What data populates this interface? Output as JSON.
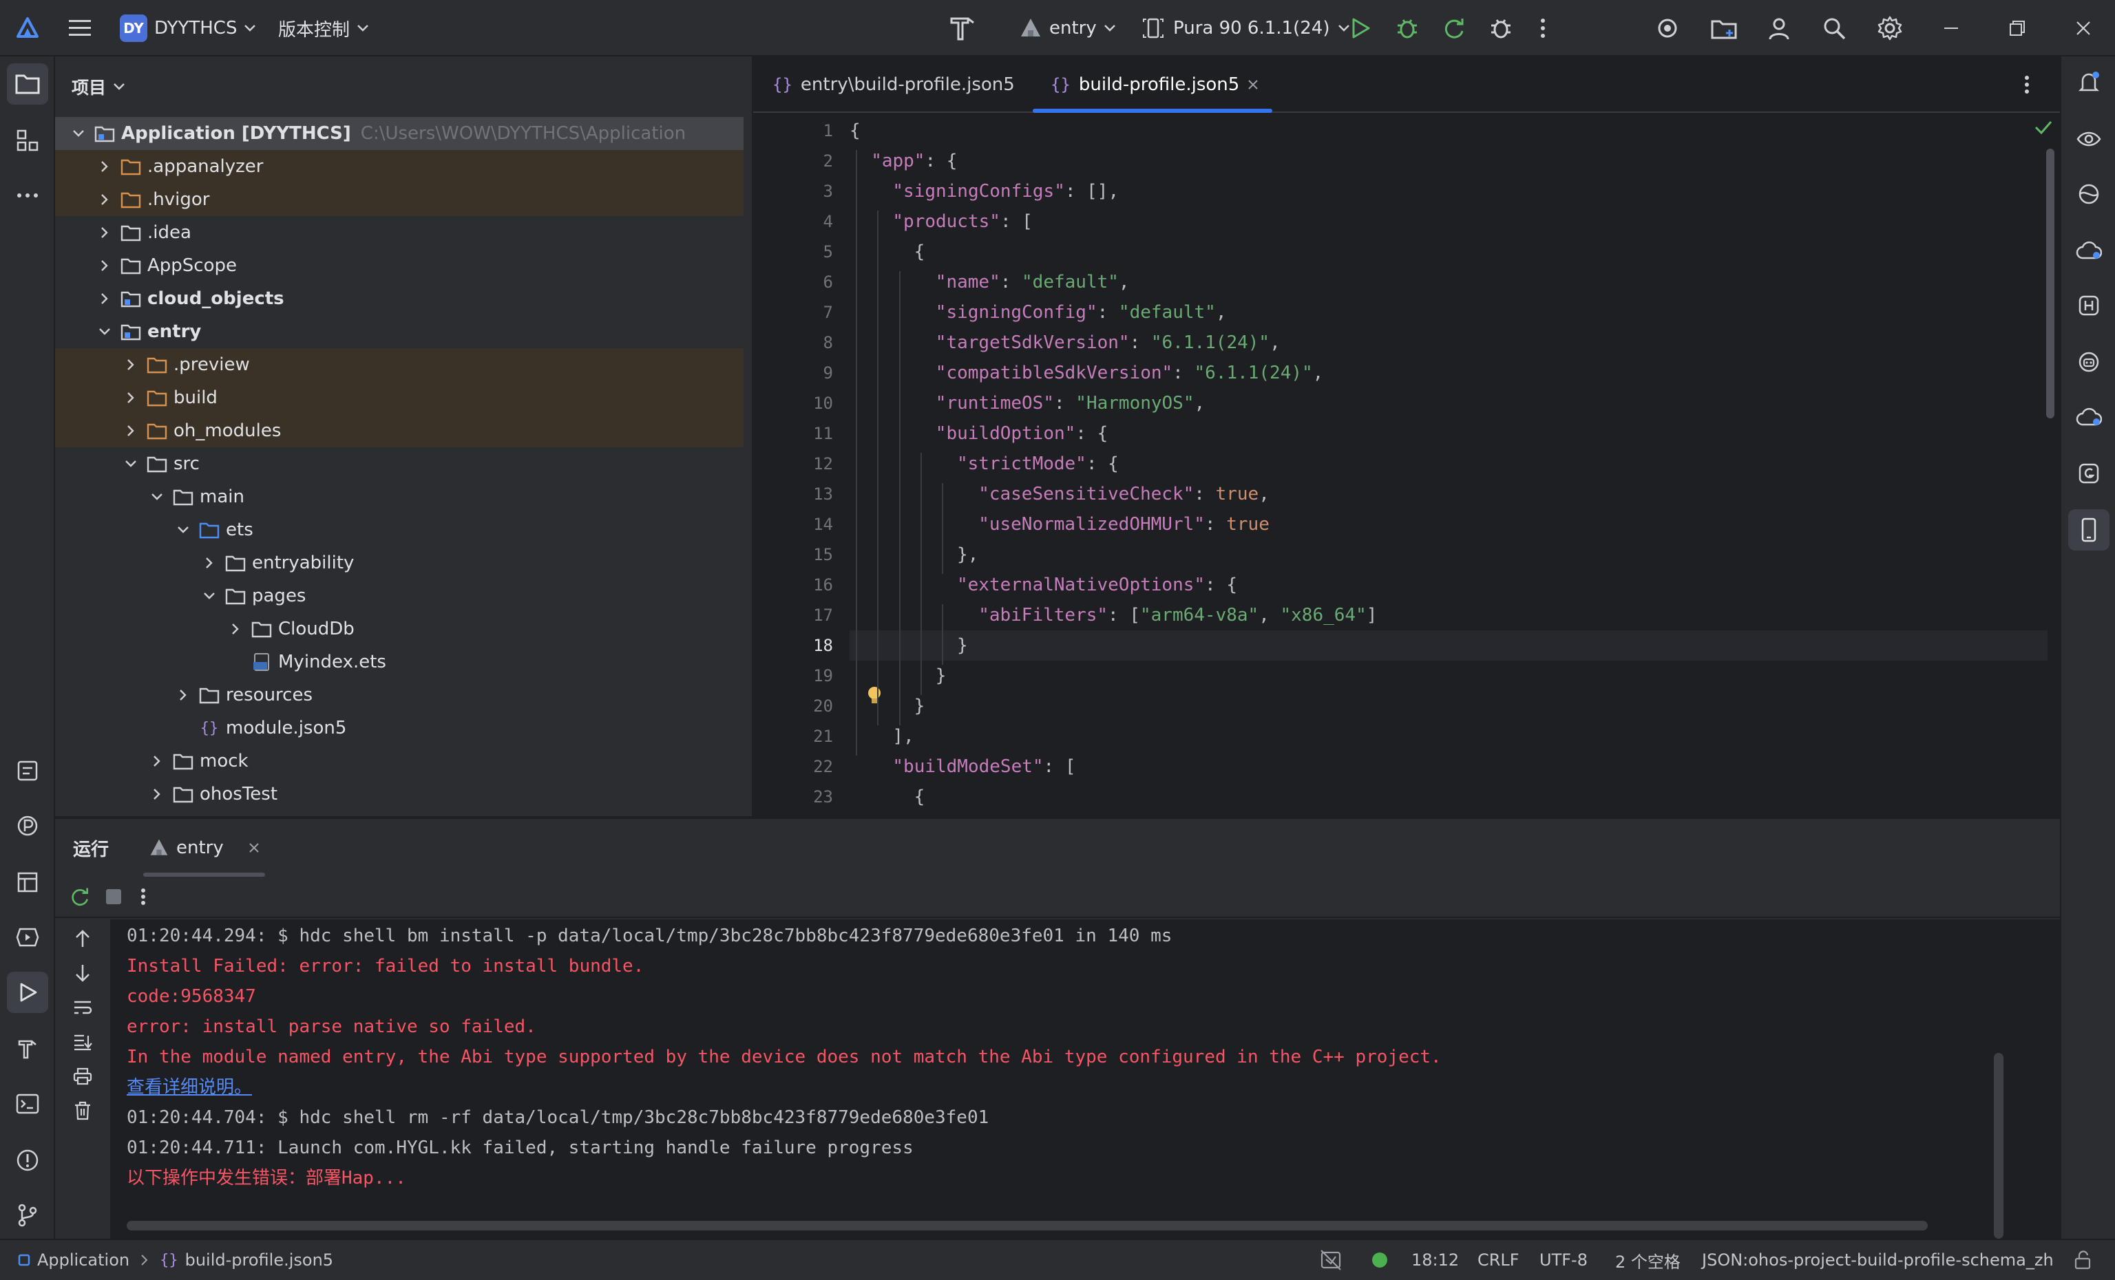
{
  "titlebar": {
    "project_badge": "DY",
    "project_name": "DYYTHCS",
    "vcs_label": "版本控制",
    "run_config": "entry",
    "device": "Pura 90 6.1.1(24)"
  },
  "project_panel": {
    "title": "项目",
    "tree": [
      {
        "name": "Application [DYYTHCS]",
        "path": "C:\\Users\\WOW\\DYYTHCS\\Application",
        "depth": 0,
        "expanded": true,
        "kind": "module",
        "highlight": "selected"
      },
      {
        "name": ".appanalyzer",
        "depth": 1,
        "expanded": false,
        "kind": "folder-orange",
        "highlight": "excluded"
      },
      {
        "name": ".hvigor",
        "depth": 1,
        "expanded": false,
        "kind": "folder-orange",
        "highlight": "excluded"
      },
      {
        "name": ".idea",
        "depth": 1,
        "expanded": false,
        "kind": "folder"
      },
      {
        "name": "AppScope",
        "depth": 1,
        "expanded": false,
        "kind": "folder"
      },
      {
        "name": "cloud_objects",
        "depth": 1,
        "expanded": false,
        "kind": "module",
        "bold": true
      },
      {
        "name": "entry",
        "depth": 1,
        "expanded": true,
        "kind": "module",
        "bold": true
      },
      {
        "name": ".preview",
        "depth": 2,
        "expanded": false,
        "kind": "folder-orange",
        "highlight": "excluded"
      },
      {
        "name": "build",
        "depth": 2,
        "expanded": false,
        "kind": "folder-orange",
        "highlight": "excluded"
      },
      {
        "name": "oh_modules",
        "depth": 2,
        "expanded": false,
        "kind": "folder-orange",
        "highlight": "excluded"
      },
      {
        "name": "src",
        "depth": 2,
        "expanded": true,
        "kind": "folder"
      },
      {
        "name": "main",
        "depth": 3,
        "expanded": true,
        "kind": "folder"
      },
      {
        "name": "ets",
        "depth": 4,
        "expanded": true,
        "kind": "folder-blue"
      },
      {
        "name": "entryability",
        "depth": 5,
        "expanded": false,
        "kind": "folder"
      },
      {
        "name": "pages",
        "depth": 5,
        "expanded": true,
        "kind": "folder"
      },
      {
        "name": "CloudDb",
        "depth": 6,
        "expanded": false,
        "kind": "folder"
      },
      {
        "name": "Myindex.ets",
        "depth": 6,
        "leaf": true,
        "kind": "ets-file"
      },
      {
        "name": "resources",
        "depth": 4,
        "expanded": false,
        "kind": "folder"
      },
      {
        "name": "module.json5",
        "depth": 4,
        "leaf": true,
        "kind": "json-file"
      },
      {
        "name": "mock",
        "depth": 3,
        "expanded": false,
        "kind": "folder"
      },
      {
        "name": "ohosTest",
        "depth": 3,
        "expanded": false,
        "kind": "folder"
      }
    ]
  },
  "editor": {
    "tabs": [
      {
        "label": "entry\\build-profile.json5",
        "active": false
      },
      {
        "label": "build-profile.json5",
        "active": true
      }
    ],
    "current_line": 18,
    "lines": [
      {
        "n": "1",
        "indent": 0,
        "tokens": [
          [
            "p",
            "{"
          ]
        ]
      },
      {
        "n": "2",
        "indent": 1,
        "tokens": [
          [
            "k",
            "\"app\""
          ],
          [
            "p",
            ": {"
          ]
        ]
      },
      {
        "n": "3",
        "indent": 2,
        "tokens": [
          [
            "k",
            "\"signingConfigs\""
          ],
          [
            "p",
            ": [],"
          ]
        ]
      },
      {
        "n": "4",
        "indent": 2,
        "tokens": [
          [
            "k",
            "\"products\""
          ],
          [
            "p",
            ": ["
          ]
        ]
      },
      {
        "n": "5",
        "indent": 3,
        "tokens": [
          [
            "p",
            "{"
          ]
        ]
      },
      {
        "n": "6",
        "indent": 4,
        "tokens": [
          [
            "k",
            "\"name\""
          ],
          [
            "p",
            ": "
          ],
          [
            "s",
            "\"default\""
          ],
          [
            "p",
            ","
          ]
        ]
      },
      {
        "n": "7",
        "indent": 4,
        "tokens": [
          [
            "k",
            "\"signingConfig\""
          ],
          [
            "p",
            ": "
          ],
          [
            "s",
            "\"default\""
          ],
          [
            "p",
            ","
          ]
        ]
      },
      {
        "n": "8",
        "indent": 4,
        "tokens": [
          [
            "k",
            "\"targetSdkVersion\""
          ],
          [
            "p",
            ": "
          ],
          [
            "s",
            "\"6.1.1(24)\""
          ],
          [
            "p",
            ","
          ]
        ]
      },
      {
        "n": "9",
        "indent": 4,
        "tokens": [
          [
            "k",
            "\"compatibleSdkVersion\""
          ],
          [
            "p",
            ": "
          ],
          [
            "s",
            "\"6.1.1(24)\""
          ],
          [
            "p",
            ","
          ]
        ]
      },
      {
        "n": "10",
        "indent": 4,
        "tokens": [
          [
            "k",
            "\"runtimeOS\""
          ],
          [
            "p",
            ": "
          ],
          [
            "s",
            "\"HarmonyOS\""
          ],
          [
            "p",
            ","
          ]
        ]
      },
      {
        "n": "11",
        "indent": 4,
        "tokens": [
          [
            "k",
            "\"buildOption\""
          ],
          [
            "p",
            ": {"
          ]
        ]
      },
      {
        "n": "12",
        "indent": 5,
        "tokens": [
          [
            "k",
            "\"strictMode\""
          ],
          [
            "p",
            ": {"
          ]
        ]
      },
      {
        "n": "13",
        "indent": 6,
        "tokens": [
          [
            "k",
            "\"caseSensitiveCheck\""
          ],
          [
            "p",
            ": "
          ],
          [
            "b",
            "true"
          ],
          [
            "p",
            ","
          ]
        ]
      },
      {
        "n": "14",
        "indent": 6,
        "tokens": [
          [
            "k",
            "\"useNormalizedOHMUrl\""
          ],
          [
            "p",
            ": "
          ],
          [
            "b",
            "true"
          ]
        ]
      },
      {
        "n": "15",
        "indent": 5,
        "tokens": [
          [
            "p",
            "},"
          ]
        ]
      },
      {
        "n": "16",
        "indent": 5,
        "tokens": [
          [
            "k",
            "\"externalNativeOptions\""
          ],
          [
            "p",
            ": {"
          ]
        ]
      },
      {
        "n": "17",
        "indent": 6,
        "tokens": [
          [
            "k",
            "\"abiFilters\""
          ],
          [
            "p",
            ": ["
          ],
          [
            "s",
            "\"arm64-v8a\""
          ],
          [
            "p",
            ", "
          ],
          [
            "s",
            "\"x86_64\""
          ],
          [
            "p",
            "]"
          ]
        ]
      },
      {
        "n": "18",
        "indent": 5,
        "tokens": [
          [
            "p",
            "}"
          ]
        ]
      },
      {
        "n": "19",
        "indent": 4,
        "tokens": [
          [
            "p",
            "}"
          ]
        ]
      },
      {
        "n": "20",
        "indent": 3,
        "tokens": [
          [
            "p",
            "}"
          ]
        ]
      },
      {
        "n": "21",
        "indent": 2,
        "tokens": [
          [
            "p",
            "],"
          ]
        ]
      },
      {
        "n": "22",
        "indent": 2,
        "tokens": [
          [
            "k",
            "\"buildModeSet\""
          ],
          [
            "p",
            ": ["
          ]
        ]
      },
      {
        "n": "23",
        "indent": 3,
        "tokens": [
          [
            "p",
            "{"
          ]
        ]
      }
    ]
  },
  "run_panel": {
    "title": "运行",
    "tab_label": "entry",
    "output": [
      {
        "text": "01:20:44.294: $ hdc shell bm install -p data/local/tmp/3bc28c7bb8bc423f8779ede680e3fe01 in 140 ms",
        "style": "norm"
      },
      {
        "text": "Install Failed: error: failed to install bundle.",
        "style": "err"
      },
      {
        "text": "code:9568347",
        "style": "err"
      },
      {
        "text": "error: install parse native so failed.",
        "style": "err"
      },
      {
        "text": "In the module named entry, the Abi type supported by the device does not match the Abi type configured in the C++ project.",
        "style": "err"
      },
      {
        "text": "查看详细说明。",
        "style": "link"
      },
      {
        "text": "01:20:44.704: $ hdc shell rm -rf data/local/tmp/3bc28c7bb8bc423f8779ede680e3fe01",
        "style": "norm"
      },
      {
        "text": "01:20:44.711: Launch com.HYGL.kk failed, starting handle failure progress",
        "style": "norm"
      },
      {
        "text": "以下操作中发生错误：部署Hap...",
        "style": "err"
      }
    ]
  },
  "statusbar": {
    "breadcrumb_root": "Application",
    "breadcrumb_file": "build-profile.json5",
    "position": "18:12",
    "line_ending": "CRLF",
    "encoding": "UTF-8",
    "indent": "2 个空格",
    "schema": "JSON:ohos-project-build-profile-schema_zh"
  },
  "colors": {
    "background": "#1e1f22",
    "panel": "#2b2d30",
    "accent": "#3574f0",
    "error": "#f75464",
    "json_key": "#c77dbb",
    "json_string": "#6aab73",
    "json_keyword": "#cf8e6d",
    "run_green": "#5fb865"
  }
}
